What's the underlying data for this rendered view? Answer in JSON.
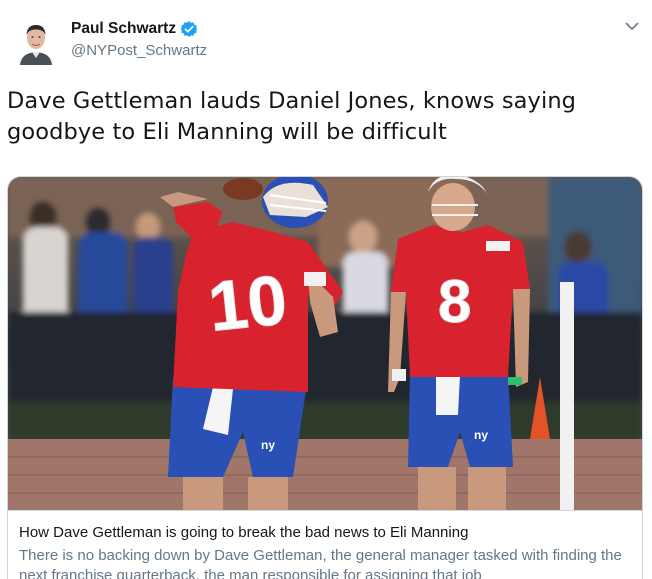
{
  "author": {
    "name": "Paul Schwartz",
    "handle": "@NYPost_Schwartz",
    "verified": true
  },
  "tweet": {
    "text": "Dave Gettleman lauds Daniel Jones, knows saying goodbye to Eli Manning will be difficult"
  },
  "card": {
    "title": "How Dave Gettleman is going to break the bad news to Eli Manning",
    "description": "There is no backing down by Dave Gettleman, the general manager tasked with finding the next franchise quarterback, the man responsible for assigning that job",
    "image": {
      "left_player_number": "10",
      "right_player_number": "8",
      "shorts_logo": "ny"
    }
  },
  "colors": {
    "verified_blue": "#1da1f2",
    "jersey_red": "#d8232f",
    "shorts_blue": "#2a4fb5",
    "handle_gray": "#657786"
  },
  "icons": {
    "menu": "chevron-down-icon",
    "badge": "verified-badge-icon"
  }
}
